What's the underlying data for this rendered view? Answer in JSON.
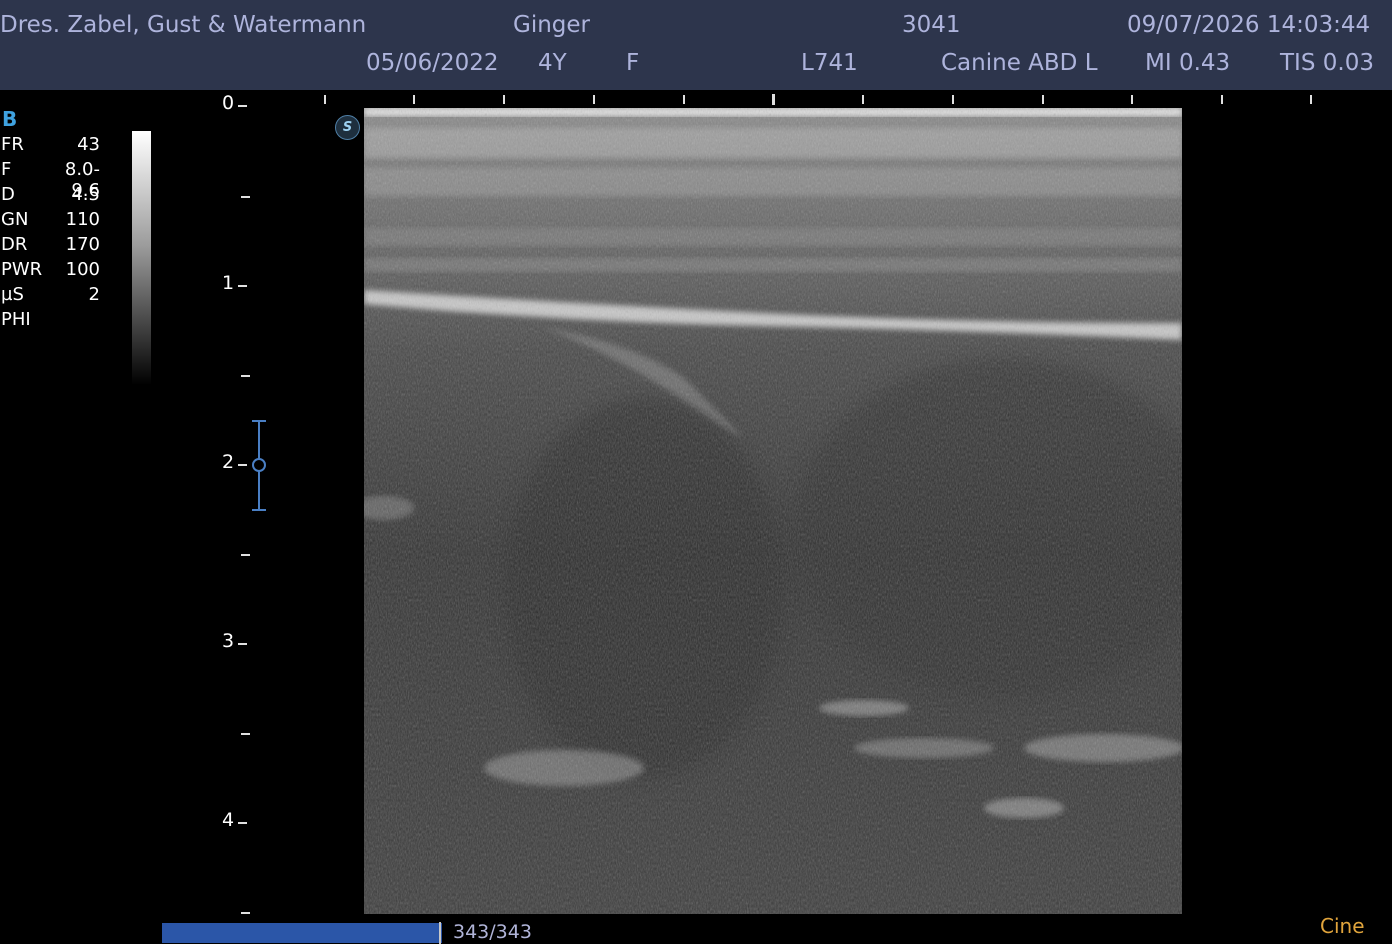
{
  "header": {
    "clinic": "Dres. Zabel, Gust & Watermann",
    "patient_name": "Ginger",
    "patient_id": "3041",
    "datetime": "09/07/2026 14:03:44",
    "birth_date": "05/06/2022",
    "age": "4Y",
    "sex": "F",
    "probe": "L741",
    "preset": "Canine ABD L",
    "mi": "MI 0.43",
    "tis": "TIS 0.03"
  },
  "imaging": {
    "mode": "B",
    "params": [
      {
        "label": "FR",
        "value": "43"
      },
      {
        "label": "F",
        "value": "8.0-9.6"
      },
      {
        "label": "D",
        "value": "4.5"
      },
      {
        "label": "GN",
        "value": "110"
      },
      {
        "label": "DR",
        "value": "170"
      },
      {
        "label": "PWR",
        "value": "100"
      },
      {
        "label": "µS",
        "value": "2"
      },
      {
        "label": "PHI",
        "value": ""
      }
    ]
  },
  "depth_scale": {
    "labels": [
      "0",
      "1",
      "2",
      "3",
      "4"
    ],
    "max_depth": 4.5,
    "focus_depth": 2.0
  },
  "icons": {
    "s_icon_label": "S",
    "s_icon": "sonoview-s-icon"
  },
  "cine": {
    "frames_text": "343/343",
    "progress": 1.0,
    "label": "Cine"
  },
  "colors": {
    "header_bg": "#2d354c",
    "header_text": "#aeb4dc",
    "mode_accent": "#3fa2e0",
    "focus_marker": "#4a7fc4",
    "cine_label": "#e0a43c",
    "cine_bar": "#2b56a8"
  }
}
